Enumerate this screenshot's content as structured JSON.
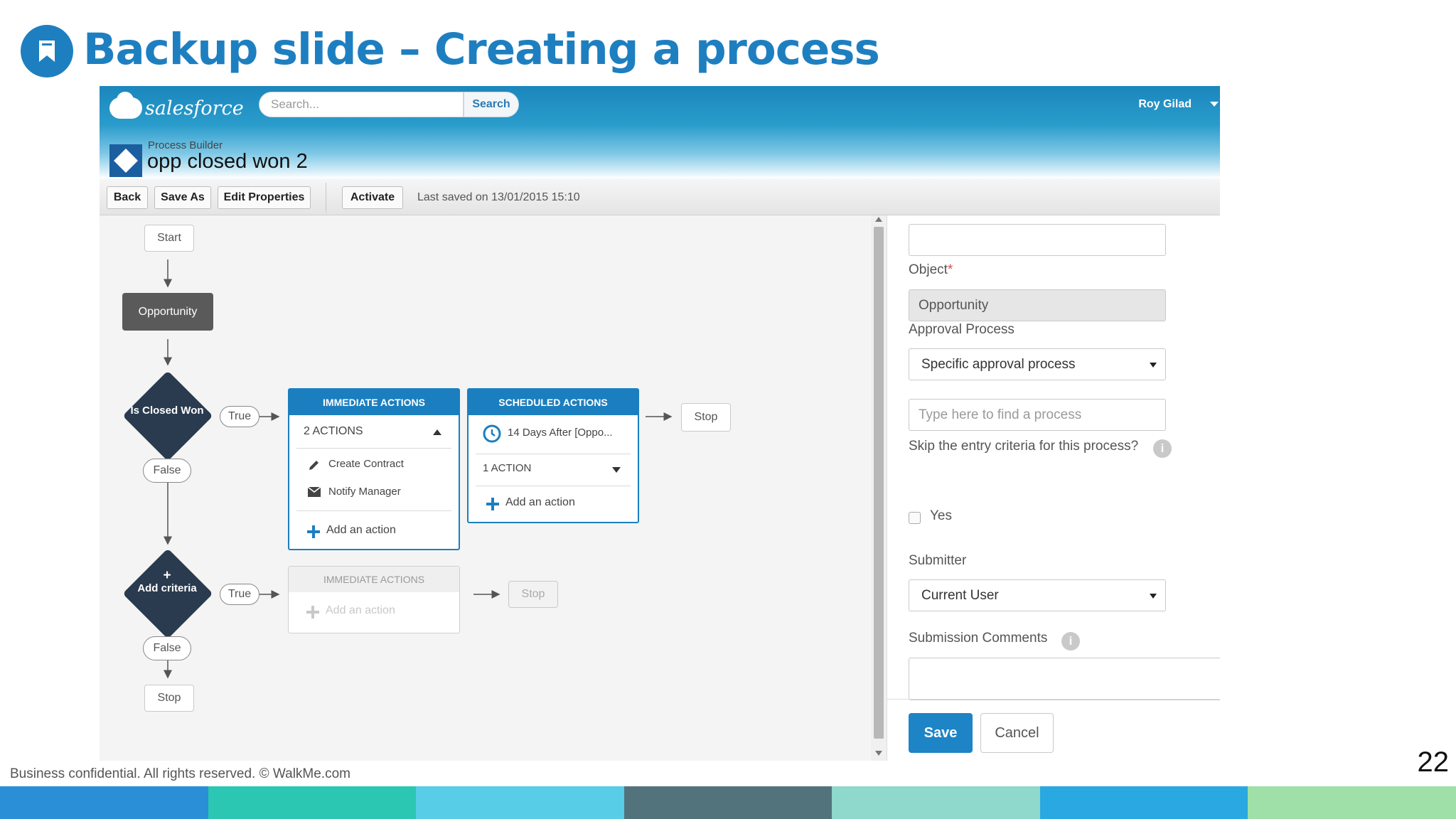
{
  "slide": {
    "title": "Backup slide – Creating a process",
    "icon": "bookmark-icon",
    "footer": "Business confidential. All rights reserved. © WalkMe.com",
    "page_number": "22",
    "footer_colors": [
      "#2a8fd6",
      "#2cc7b3",
      "#57cde8",
      "#53737c",
      "#8ed8cc",
      "#29a8e1",
      "#9ee0a7"
    ]
  },
  "salesforce": {
    "logo_text": "salesforce",
    "search_placeholder": "Search...",
    "search_button": "Search",
    "user_name": "Roy Gilad"
  },
  "process": {
    "label": "Process Builder",
    "name": "opp closed won 2"
  },
  "toolbar": {
    "back": "Back",
    "save_as": "Save As",
    "edit_properties": "Edit Properties",
    "activate": "Activate",
    "last_saved": "Last saved on 13/01/2015 15:10"
  },
  "canvas": {
    "start": "Start",
    "object_node": "Opportunity",
    "criteria_1": "Is Closed Won",
    "criteria_2": "Add criteria",
    "true_label": "True",
    "false_label": "False",
    "stop": "Stop",
    "immediate_header": "IMMEDIATE ACTIONS",
    "scheduled_header": "SCHEDULED ACTIONS",
    "immediate_count": "2  ACTIONS",
    "immediate_items": [
      "Create Contract",
      "Notify Manager"
    ],
    "scheduled_time": "14 Days After [Oppo...",
    "scheduled_count": "1  ACTION",
    "add_action": "Add an action"
  },
  "panel": {
    "object_label": "Object",
    "object_value": "Opportunity",
    "approval_label": "Approval Process",
    "approval_value": "Specific approval process",
    "find_placeholder": "Type here to find a process",
    "skip_label": "Skip the entry criteria for this process?",
    "yes_label": "Yes",
    "submitter_label": "Submitter",
    "submitter_value": "Current User",
    "comments_label": "Submission Comments",
    "save": "Save",
    "cancel": "Cancel"
  }
}
